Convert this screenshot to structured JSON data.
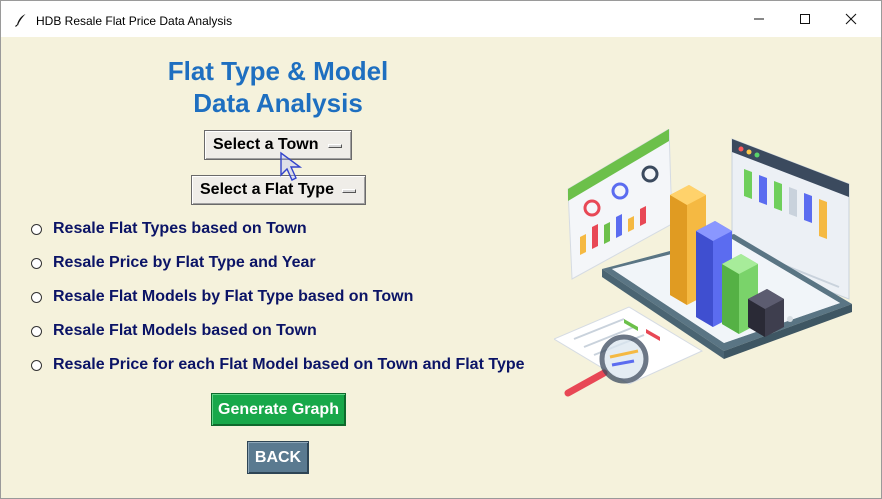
{
  "window": {
    "title": "HDB Resale Flat Price Data Analysis",
    "controls": [
      "minimize",
      "maximize",
      "close"
    ]
  },
  "heading": {
    "line1": "Flat Type & Model",
    "line2": "Data Analysis"
  },
  "menus": {
    "town_label": "Select a Town",
    "flat_type_label": "Select a Flat Type"
  },
  "options": [
    "Resale Flat Types based on Town",
    "Resale Price by Flat Type and Year",
    "Resale Flat Models by Flat Type based on Town",
    "Resale Flat Models based on Town",
    "Resale Price for each Flat Model based on Town and Flat Type"
  ],
  "buttons": {
    "generate": "Generate Graph",
    "back": "BACK"
  },
  "colors": {
    "background": "#f5f2dc",
    "heading": "#1e6fc0",
    "option_text": "#0b1466",
    "generate_bg": "#18a84a",
    "back_bg": "#5a7a90"
  },
  "icons": [
    "feather-icon",
    "data-analytics-illustration",
    "mouse-pointer-icon"
  ]
}
